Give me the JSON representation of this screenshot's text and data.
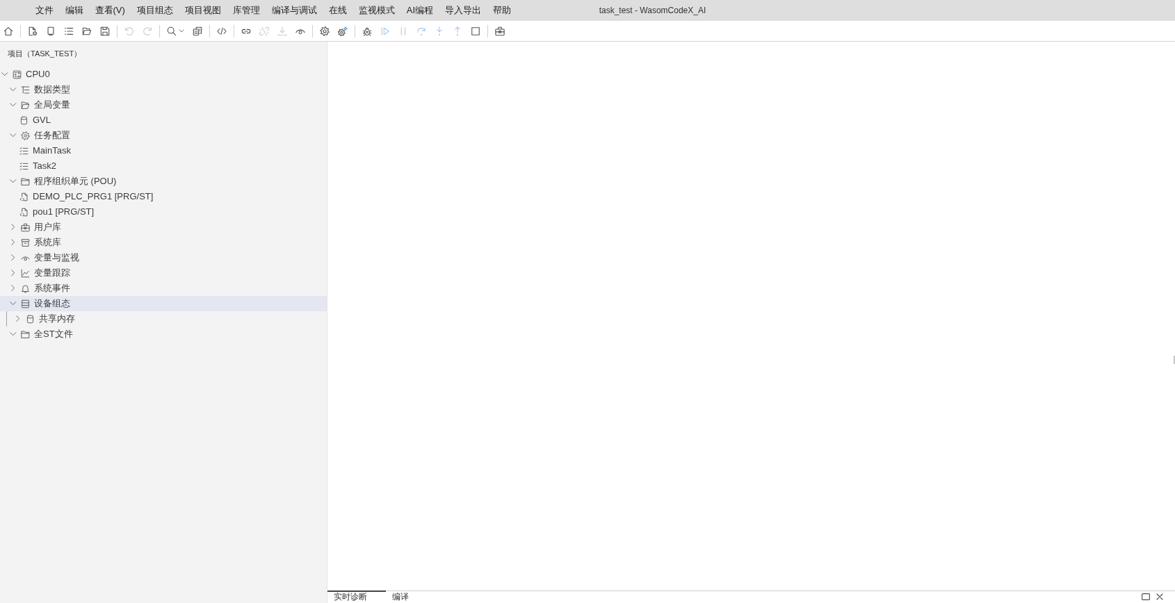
{
  "window": {
    "title": "task_test - WasomCodeX_AI"
  },
  "menu": [
    "文件",
    "编辑",
    "查看(V)",
    "项目组态",
    "项目视图",
    "库管理",
    "编译与调试",
    "在线",
    "监视模式",
    "AI编程",
    "导入导出",
    "帮助"
  ],
  "toolbar": {
    "groups": [
      [
        {
          "kind": "button",
          "disabled": false
        }
      ],
      [
        {
          "kind": "button",
          "disabled": false
        },
        {
          "kind": "button",
          "disabled": false
        },
        {
          "kind": "button",
          "disabled": false
        },
        {
          "kind": "button",
          "disabled": false
        },
        {
          "kind": "button",
          "disabled": false
        }
      ],
      [
        {
          "kind": "button",
          "disabled": true
        },
        {
          "kind": "button",
          "disabled": true
        }
      ],
      [
        {
          "kind": "dropdown",
          "disabled": false
        },
        {
          "kind": "button",
          "disabled": false
        }
      ],
      [
        {
          "kind": "button",
          "disabled": false
        }
      ],
      [
        {
          "kind": "button",
          "disabled": false
        },
        {
          "kind": "button",
          "disabled": true
        },
        {
          "kind": "button",
          "disabled": true
        },
        {
          "kind": "button",
          "disabled": false
        }
      ],
      [
        {
          "kind": "button",
          "disabled": false
        },
        {
          "kind": "button",
          "disabled": false
        }
      ],
      [
        {
          "kind": "button",
          "disabled": false
        },
        {
          "kind": "button",
          "disabled": true
        },
        {
          "kind": "button",
          "disabled": true
        },
        {
          "kind": "button",
          "disabled": true
        },
        {
          "kind": "button",
          "disabled": true
        },
        {
          "kind": "button",
          "disabled": true
        },
        {
          "kind": "button",
          "disabled": false
        }
      ],
      [
        {
          "kind": "button",
          "disabled": false
        }
      ]
    ]
  },
  "sidebar": {
    "title": "项目（TASK_TEST）",
    "tree": [
      {
        "label": "CPU0",
        "kind": "device",
        "expanded": true,
        "selected": false,
        "children": [
          {
            "label": "数据类型",
            "kind": "types",
            "expanded": true,
            "selected": false
          },
          {
            "label": "全局变量",
            "kind": "globals",
            "expanded": true,
            "selected": false,
            "children": [
              {
                "label": "GVL",
                "kind": "gvl",
                "selected": false
              }
            ]
          },
          {
            "label": "任务配置",
            "kind": "config",
            "expanded": true,
            "selected": false,
            "children": [
              {
                "label": "MainTask",
                "kind": "task",
                "selected": false
              },
              {
                "label": "Task2",
                "kind": "task",
                "selected": false
              }
            ]
          },
          {
            "label": "程序组织单元 (POU)",
            "kind": "folder",
            "expanded": true,
            "selected": false,
            "children": [
              {
                "label": "DEMO_PLC_PRG1 [PRG/ST]",
                "kind": "program",
                "selected": false
              },
              {
                "label": "pou1 [PRG/ST]",
                "kind": "program",
                "selected": false
              }
            ]
          },
          {
            "label": "用户库",
            "kind": "library",
            "expanded": false,
            "selected": false
          },
          {
            "label": "系统库",
            "kind": "archive",
            "expanded": false,
            "selected": false
          },
          {
            "label": "变量与监视",
            "kind": "watch",
            "expanded": false,
            "selected": false
          },
          {
            "label": "变量跟踪",
            "kind": "trace",
            "expanded": false,
            "selected": false
          },
          {
            "label": "系统事件",
            "kind": "events",
            "expanded": false,
            "selected": false
          },
          {
            "label": "设备组态",
            "kind": "hardware",
            "expanded": true,
            "selected": true,
            "children": [
              {
                "label": "共享内存",
                "kind": "memory",
                "expanded": false,
                "selected": false
              }
            ]
          },
          {
            "label": "全ST文件",
            "kind": "folder",
            "expanded": true,
            "selected": false
          }
        ]
      }
    ]
  },
  "bottom_panel": {
    "tabs": [
      {
        "label": "实时诊断",
        "selected": true
      },
      {
        "label": "编译",
        "selected": false
      }
    ]
  }
}
